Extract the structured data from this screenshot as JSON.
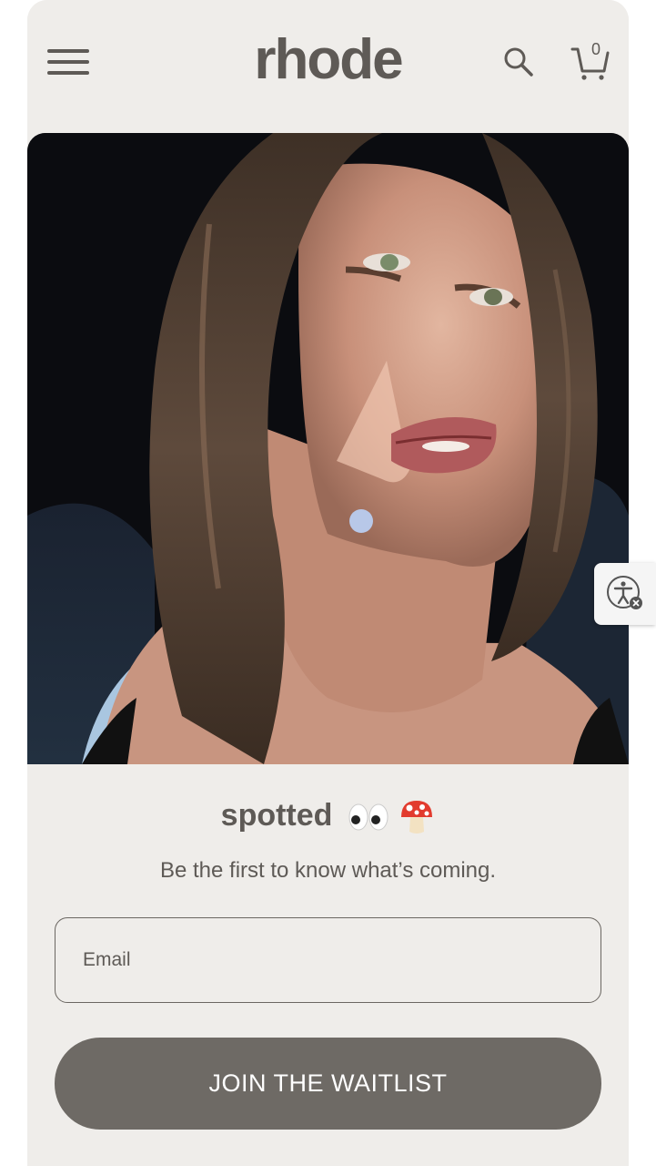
{
  "header": {
    "logo": "rhode",
    "cart_count": "0",
    "icons": {
      "menu": "hamburger-menu-icon",
      "search": "search-icon",
      "cart": "cart-icon"
    }
  },
  "hero": {
    "image": "photo-woman-selfie-in-car"
  },
  "accessibility": {
    "icon": "accessibility-icon"
  },
  "promo": {
    "title": "spotted",
    "emojis": [
      "eyes-emoji",
      "mushroom-emoji"
    ],
    "subtitle": "Be the first to know what’s coming."
  },
  "form": {
    "email_placeholder": "Email",
    "email_value": "",
    "submit_label": "JOIN THE WAITLIST"
  },
  "colors": {
    "background": "#efedea",
    "text": "#5e5a56",
    "button": "#6e6a65",
    "button_text": "#ffffff"
  }
}
